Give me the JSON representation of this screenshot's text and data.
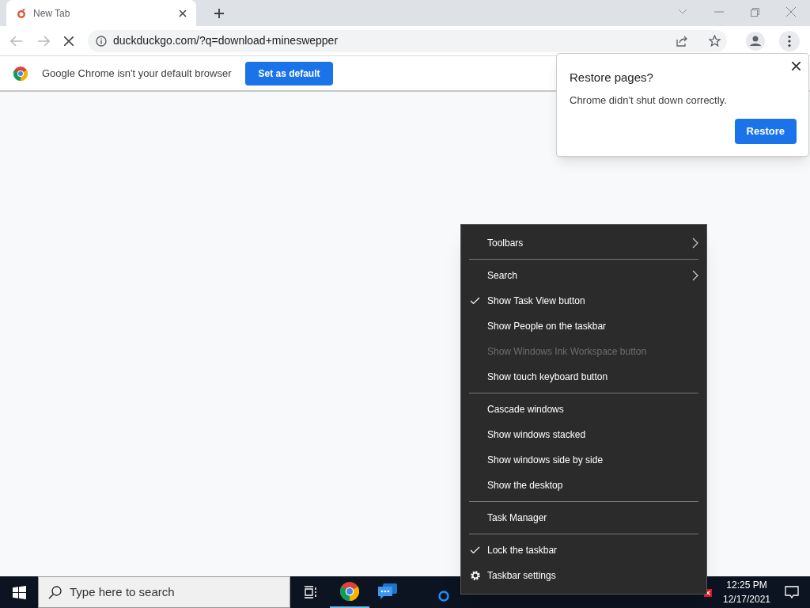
{
  "browser": {
    "tab": {
      "title": "New Tab",
      "selected": true
    },
    "address": "duckduckgo.com/?q=download+mineswepper",
    "infobar": {
      "message": "Google Chrome isn't your default browser",
      "button": "Set as default"
    }
  },
  "restore_bubble": {
    "title": "Restore pages?",
    "message": "Chrome didn't shut down correctly.",
    "button": "Restore"
  },
  "context_menu": {
    "items": [
      {
        "kind": "item",
        "label": "Toolbars",
        "submenu": true,
        "checked": false,
        "disabled": false
      },
      {
        "kind": "separator"
      },
      {
        "kind": "item",
        "label": "Search",
        "submenu": true,
        "checked": false,
        "disabled": false
      },
      {
        "kind": "item",
        "label": "Show Task View button",
        "submenu": false,
        "checked": true,
        "disabled": false
      },
      {
        "kind": "item",
        "label": "Show People on the taskbar",
        "submenu": false,
        "checked": false,
        "disabled": false
      },
      {
        "kind": "item",
        "label": "Show Windows Ink Workspace button",
        "submenu": false,
        "checked": false,
        "disabled": true
      },
      {
        "kind": "item",
        "label": "Show touch keyboard button",
        "submenu": false,
        "checked": false,
        "disabled": false
      },
      {
        "kind": "separator"
      },
      {
        "kind": "item",
        "label": "Cascade windows",
        "submenu": false,
        "checked": false,
        "disabled": false
      },
      {
        "kind": "item",
        "label": "Show windows stacked",
        "submenu": false,
        "checked": false,
        "disabled": false
      },
      {
        "kind": "item",
        "label": "Show windows side by side",
        "submenu": false,
        "checked": false,
        "disabled": false
      },
      {
        "kind": "item",
        "label": "Show the desktop",
        "submenu": false,
        "checked": false,
        "disabled": false
      },
      {
        "kind": "separator"
      },
      {
        "kind": "item",
        "label": "Task Manager",
        "submenu": false,
        "checked": false,
        "disabled": false
      },
      {
        "kind": "separator"
      },
      {
        "kind": "item",
        "label": "Lock the taskbar",
        "submenu": false,
        "checked": true,
        "disabled": false
      },
      {
        "kind": "settings",
        "label": "Taskbar settings",
        "submenu": false,
        "checked": false,
        "disabled": false
      }
    ]
  },
  "taskbar": {
    "search_placeholder": "Type here to search",
    "time": "12:25 PM",
    "date": "12/17/2021"
  }
}
